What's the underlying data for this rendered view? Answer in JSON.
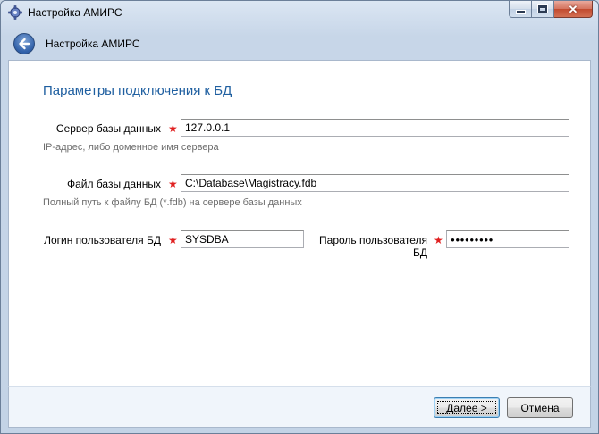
{
  "window": {
    "title": "Настройка АМИРС"
  },
  "nav": {
    "title": "Настройка АМИРС"
  },
  "section": {
    "title": "Параметры подключения к БД"
  },
  "fields": {
    "server": {
      "label": "Сервер базы данных",
      "value": "127.0.0.1",
      "hint": "IP-адрес, либо доменное имя сервера"
    },
    "dbfile": {
      "label": "Файл базы данных",
      "value": "C:\\Database\\Magistracy.fdb",
      "hint": "Полный путь к файлу БД (*.fdb) на сервере базы данных"
    },
    "login": {
      "label": "Логин пользователя БД",
      "value": "SYSDBA"
    },
    "password": {
      "label": "Пароль пользователя БД",
      "value": "●●●●●●●●●"
    },
    "required_mark": "★"
  },
  "footer": {
    "next_label": "Далее >",
    "cancel_label": "Отмена"
  },
  "colors": {
    "accent": "#1f5fa0",
    "required": "#e02020"
  }
}
